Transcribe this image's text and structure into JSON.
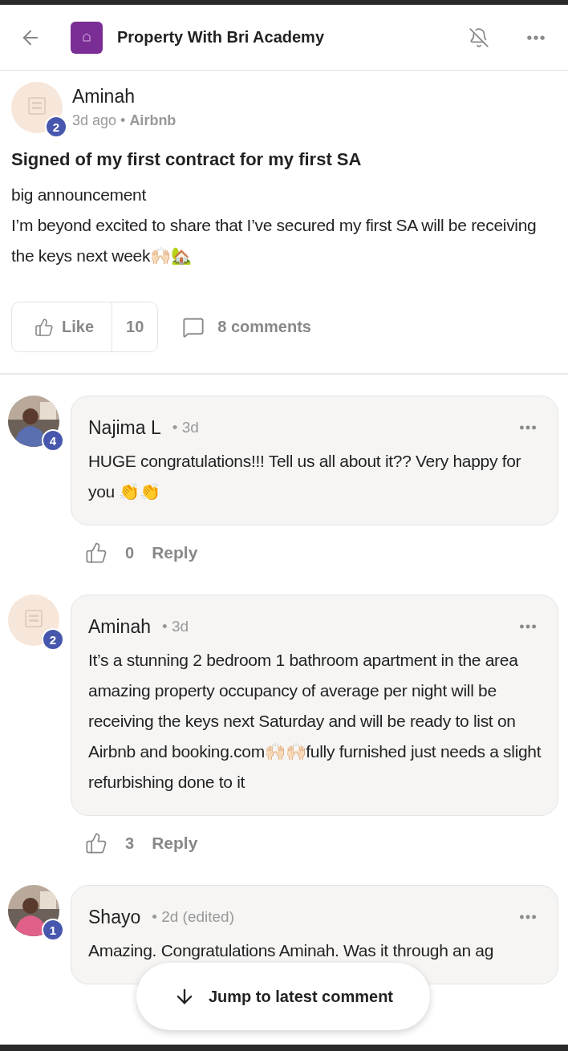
{
  "header": {
    "title": "Property With Bri Academy"
  },
  "post": {
    "author": "Aminah",
    "level": "2",
    "time": "3d ago",
    "separator": "•",
    "topic": "Airbnb",
    "title": "Signed of my first contract for my first SA",
    "body": [
      "big announcement",
      "I’m beyond excited to share that I’ve secured my first SA will be receiving the keys next week🙌🏻🏡"
    ],
    "like_label": "Like",
    "like_count": "10",
    "comments_label": "8 comments"
  },
  "comments": [
    {
      "author": "Najima L",
      "level": "4",
      "time": "• 3d",
      "text": "HUGE congratulations!!! Tell us all about it?? Very happy for you 👏👏",
      "likes": "0",
      "reply": "Reply"
    },
    {
      "author": "Aminah",
      "level": "2",
      "time": "• 3d",
      "kind": "logo",
      "text": "It’s a stunning 2 bedroom 1 bathroom apartment in the area amazing property occupancy of average per night will be receiving the keys next Saturday and will be ready to list on Airbnb and booking.com🙌🏻🙌🏻fully furnished just needs a slight refurbishing done to it",
      "likes": "3",
      "reply": "Reply"
    },
    {
      "author": "Shayo",
      "level": "1",
      "time": "• 2d (edited)",
      "text": "Amazing. Congratulations Aminah. Was it through an ag"
    }
  ],
  "jump_button": {
    "label": "Jump to latest comment"
  }
}
